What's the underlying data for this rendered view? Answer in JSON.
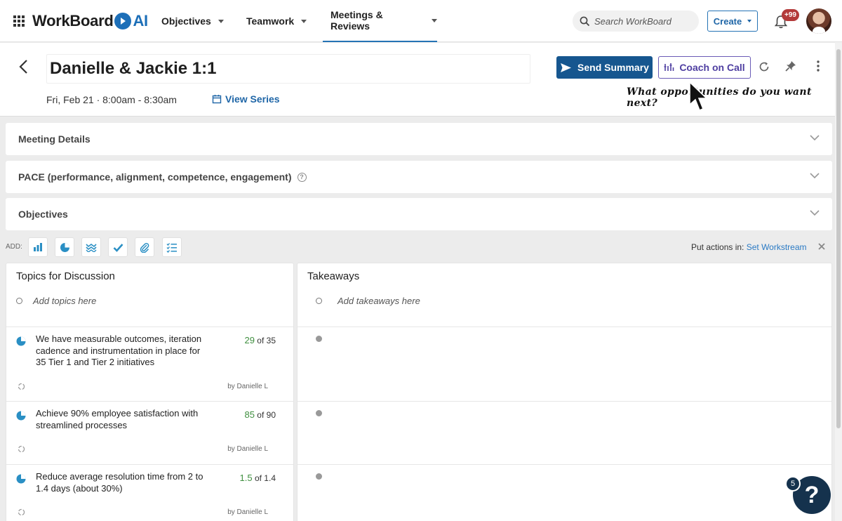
{
  "brand": {
    "name": "WorkBoard",
    "suffix": "AI"
  },
  "nav": {
    "items": [
      {
        "label": "Objectives"
      },
      {
        "label": "Teamwork"
      },
      {
        "label": "Meetings & Reviews"
      }
    ],
    "search_placeholder": "Search WorkBoard",
    "create_label": "Create",
    "notification_count": "+99"
  },
  "meeting": {
    "title": "Danielle & Jackie 1:1",
    "datetime": "Fri, Feb 21 · 8:00am - 8:30am",
    "view_series": "View Series",
    "send_summary": "Send Summary",
    "coach_on_call": "Coach on Call",
    "hint": "What opportunities do you want next?"
  },
  "panels": [
    {
      "label": "Meeting Details"
    },
    {
      "label": "PACE (performance, alignment, competence, engagement)"
    },
    {
      "label": "Objectives"
    }
  ],
  "add_toolbar": {
    "label": "ADD:",
    "tools": [
      "bar-chart-icon",
      "pie-chart-icon",
      "waves-icon",
      "check-icon",
      "paperclip-icon",
      "checklist-icon"
    ],
    "put_actions_prefix": "Put actions in:",
    "put_actions_link": "Set Workstream"
  },
  "topics": {
    "title": "Topics for Discussion",
    "add_placeholder": "Add topics here",
    "items": [
      {
        "text": "We have measurable outcomes, iteration cadence and instrumentation in place for 35 Tier 1 and Tier 2 initiatives",
        "current": "29",
        "target": "of 35",
        "by": "by Danielle L"
      },
      {
        "text": "Achieve 90% employee satisfaction with streamlined processes",
        "current": "85",
        "target": "of 90",
        "by": "by Danielle L"
      },
      {
        "text": "Reduce average resolution time from 2 to 1.4 days (about 30%)",
        "current": "1.5",
        "target": "of 1.4",
        "by": "by Danielle L"
      }
    ]
  },
  "takeaways": {
    "title": "Takeaways",
    "add_placeholder": "Add takeaways here"
  },
  "help": {
    "glyph": "?",
    "count": "5"
  },
  "colors": {
    "primary": "#16568f",
    "coach": "#4f3fa1",
    "accent_green": "#3f8f3f",
    "badge": "#b33a3a"
  }
}
